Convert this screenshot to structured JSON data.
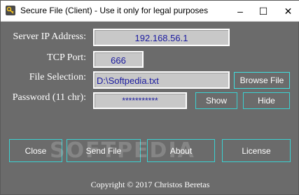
{
  "window": {
    "title": "Secure File (Client) - Use it only for legal purposes",
    "icon": "key-app-icon",
    "controls": {
      "minimize": "–",
      "maximize": "☐",
      "close": "✕"
    }
  },
  "form": {
    "server_ip": {
      "label": "Server IP Address:",
      "value": "192.168.56.1"
    },
    "tcp_port": {
      "label": "TCP Port:",
      "value": "666"
    },
    "file_selection": {
      "label": "File Selection:",
      "value": "D:\\Softpedia.txt",
      "browse_label": "Browse File"
    },
    "password": {
      "label": "Password (11 chr):",
      "value": "***********",
      "show_label": "Show",
      "hide_label": "Hide"
    }
  },
  "actions": {
    "close": "Close",
    "send_file": "Send File",
    "about": "About",
    "license": "License"
  },
  "footer": {
    "copyright": "Copyright © 2017 Christos Beretas"
  },
  "watermark": "SOFTPEDIA",
  "colors": {
    "background": "#6b6b6b",
    "field_background": "#c8c8c8",
    "field_text": "#1a1aa0",
    "button_border": "#3bd1d1",
    "label_text": "#ffffff"
  }
}
